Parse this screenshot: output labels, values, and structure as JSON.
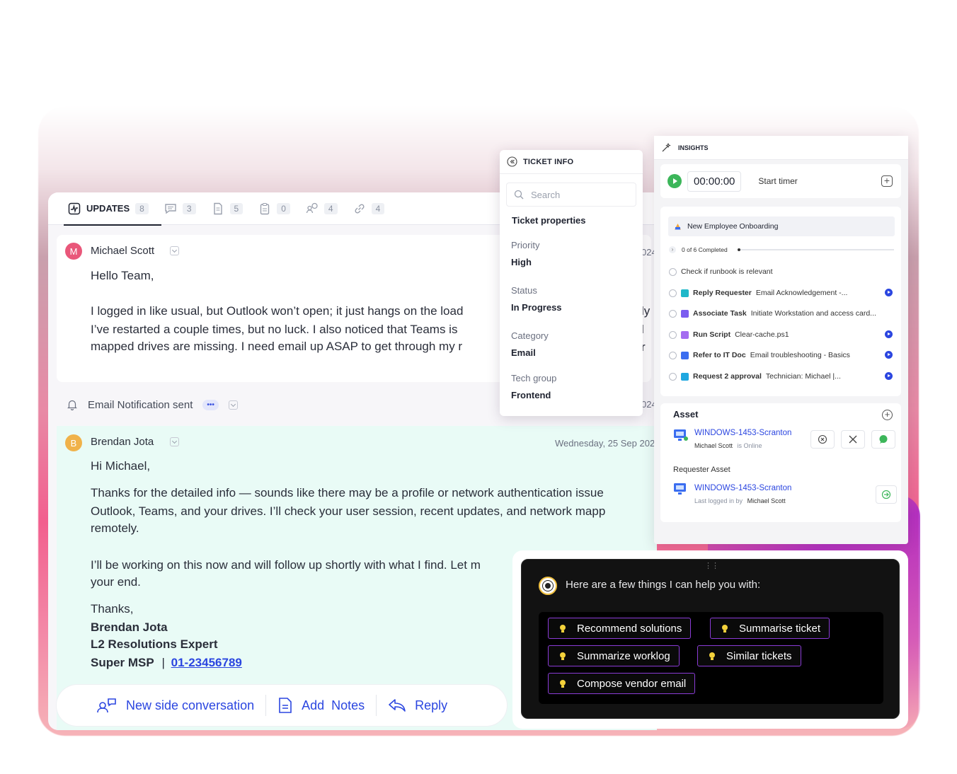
{
  "tabs": [
    {
      "label": "UPDATES",
      "count": "8"
    },
    {
      "label": "",
      "count": "3"
    },
    {
      "label": "",
      "count": "5"
    },
    {
      "label": "",
      "count": "0"
    },
    {
      "label": "",
      "count": "4"
    },
    {
      "label": "",
      "count": "4"
    }
  ],
  "message1": {
    "avatar": "M",
    "sender": "Michael Scott",
    "date_fragment": "024",
    "greeting": "Hello Team,",
    "line1": "I logged in like usual, but Outlook won’t open; it just hangs on the load",
    "line1_tail": "ly",
    "line2": "I’ve restarted a couple times, but no luck. I also noticed that Teams is",
    "line2_tail": "l r",
    "line3": "mapped drives are missing. I need email up ASAP to get through my r"
  },
  "notification": {
    "text": "Email Notification sent",
    "more": "•••",
    "date_fragment": "024"
  },
  "message2": {
    "avatar": "B",
    "sender": "Brendan Jota",
    "date": "Wednesday, 25 Sep 202",
    "greeting": "Hi Michael,",
    "p1_line1": "Thanks for the detailed info — sounds like there may be a profile or network authentication issue",
    "p1_line2": "Outlook, Teams, and your drives. I’ll check your user session, recent updates, and network mapp",
    "p1_line3": "remotely.",
    "p2_line1": "I’ll be working on this now and will follow up shortly with what I find. Let m",
    "p2_line2": "your end.",
    "sign_thanks": "Thanks,",
    "sign_name": "Brendan Jota",
    "sign_title": "L2 Resolutions Expert",
    "sign_company": "Super MSP",
    "sign_sep": "|",
    "sign_phone": "01-23456789"
  },
  "actions": {
    "side": "New side conversation",
    "notes": "Add  Notes",
    "reply": "Reply"
  },
  "ticket_info": {
    "title": "TICKET INFO",
    "search_placeholder": "Search",
    "section": "Ticket properties",
    "priority_label": "Priority",
    "priority": "High",
    "status_label": "Status",
    "status": "In Progress",
    "category_label": "Category",
    "category": "Email",
    "group_label": "Tech group",
    "group": "Frontend"
  },
  "insights": {
    "title": "INSIGHTS",
    "timer": "00:00:00",
    "start_timer": "Start timer",
    "runbook_title": "New Employee Onboarding",
    "progress_text": "0 of 6 Completed",
    "progress_fraction": 0.0,
    "steps": [
      {
        "bold": "",
        "text": "Check if runbook is relevant",
        "color": ""
      },
      {
        "bold": "Reply Requester",
        "text": "Email Acknowledgement -...",
        "color": "#1fb8c9"
      },
      {
        "bold": "Associate Task",
        "text": "Initiate Workstation and access card...",
        "color": "#7b5cf0"
      },
      {
        "bold": "Run Script",
        "text": "Clear-cache.ps1",
        "color": "#a46cf0"
      },
      {
        "bold": "Refer to IT Doc",
        "text": "Email troubleshooting - Basics",
        "color": "#3a6df0"
      },
      {
        "bold": "Request 2 approval",
        "text": "Technician: Michael |...",
        "color": "#1fa7e0"
      }
    ],
    "asset_title": "Asset",
    "asset_name": "WINDOWS-1453-Scranton",
    "asset_user": "Michael Scott",
    "asset_status": "is Online",
    "requester_title": "Requester Asset",
    "req_asset_name": "WINDOWS-1453-Scranton",
    "req_last": "Last logged in by",
    "req_user": "Michael Scott"
  },
  "ai": {
    "handle": "⋮⋮",
    "intro": "Here are a few things I can help you with:",
    "suggestions": [
      "Recommend solutions",
      "Summarise ticket",
      "Summarize worklog",
      "Similar tickets",
      "Compose vendor email"
    ]
  }
}
